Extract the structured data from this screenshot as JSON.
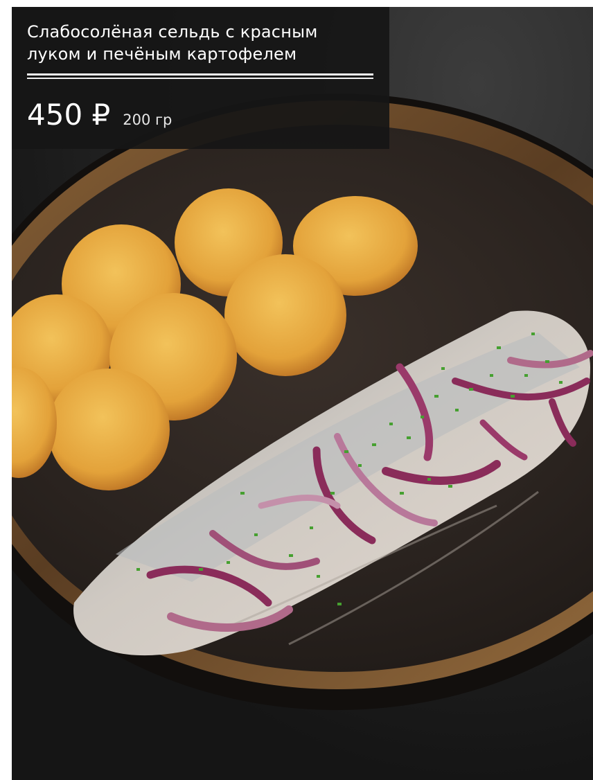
{
  "dish": {
    "title": "Слабосолёная сельдь с красным луком и печёным картофелем",
    "price": "450 ₽",
    "weight": "200 гр"
  },
  "photo": {
    "subject": "herring-with-onion-and-potatoes",
    "colors": {
      "background": "#1c1c1c",
      "plate_rim": "#6b4a2a",
      "plate_inner": "#2b2420",
      "potato": "#e2a640",
      "herring": "#c9c4bf",
      "onion": "#8a2c5a",
      "chives": "#3f8a2a"
    }
  },
  "overlay": {
    "background": "rgba(22,22,22,0.92)",
    "text_color": "#ffffff"
  }
}
